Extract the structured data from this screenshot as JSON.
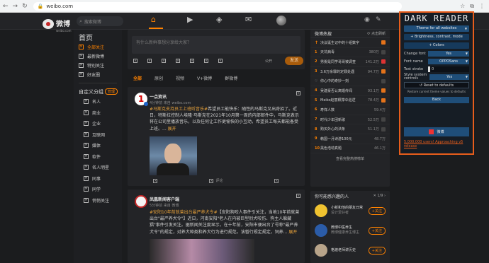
{
  "browser": {
    "url": "weibo.com"
  },
  "topbar": {
    "logo_text": "微博",
    "logo_sub": "weibo.com",
    "search_placeholder": "搜索微博"
  },
  "leftnav": {
    "title": "首页",
    "items": [
      {
        "label": "全部关注",
        "active": true
      },
      {
        "label": "最新微博"
      },
      {
        "label": "特别关注"
      },
      {
        "label": "好友圈"
      }
    ],
    "group_title": "自定义分组",
    "group_manage": "管理",
    "groups": [
      "名人",
      "商业",
      "企业",
      "互联网",
      "媒体",
      "软件",
      "名人明星",
      "同事",
      "同学",
      "悄悄关注"
    ]
  },
  "composer": {
    "placeholder": "有什么新鲜事想分享给大家？",
    "public_label": "公开",
    "send_label": "发送"
  },
  "tabs": [
    "全部",
    "原创",
    "视频",
    "V+微博",
    "群微博"
  ],
  "feed": [
    {
      "name": "一点资讯",
      "meta": "4分钟前 来自 weibo.com",
      "tag": "#马斯克支持员工上班听音乐#",
      "text": "希望员工能快乐：随性的马斯克又出奇招了。近日，特斯拉控制人埃隆·马斯克在2021年10月第一周的内部邮件中，马斯克表示将在公司里播放音乐，以及任何让工作更愉快的小互动，希望员工每天都能备受上班。...",
      "more": "展开",
      "actions": [
        "",
        "评论",
        ""
      ]
    },
    {
      "name": "凤凰新闻客户端",
      "meta": "5分钟前 来自 微博",
      "tag": "#安阳10年前就曾出台最严养犬令#",
      "text": "【安阳狗咬人事件引关注，当地10年前就曾出台\"最严养犬令\"】近日，河南安阳\"老人在内被巨型烈犬咬伤、狗主人躲藏猖\"事件引发关注。据新闻关注度显示，在十年前，安阳市便出台了号称\"最严养犬令\"的规定，对养犬种类和养犬行为进行规范。该暂行规定规定，饲养...",
      "more": "展开"
    }
  ],
  "hot": {
    "title": "微博热搜",
    "refresh": "点击刷新",
    "rows": [
      {
        "rank": "",
        "title": "决议诞生记中的十组数字",
        "num": "",
        "badge": "orange"
      },
      {
        "rank": "1",
        "title": "天坑病毒",
        "num": "380万",
        "badge": "grey"
      },
      {
        "rank": "2",
        "title": "男婴是同学哥哥被调查",
        "num": "141.2万",
        "badge": "red"
      },
      {
        "rank": "3",
        "title": "3.6万余罪的定罪处遇",
        "num": "94.7万",
        "badge": "orange"
      },
      {
        "rank": "",
        "title": "你心中的奇妙一刻",
        "num": "",
        "badge": "grey"
      },
      {
        "rank": "4",
        "title": "吴建豪否认离婚传闻",
        "num": "93.1万",
        "badge": "orange"
      },
      {
        "rank": "5",
        "title": "Meiko赵丽颖撑伞巡逻",
        "num": "78.4万",
        "badge": "orange"
      },
      {
        "rank": "6",
        "title": "寿祥人数",
        "num": "59.4万",
        "badge": "grey"
      },
      {
        "rank": "7",
        "title": "时代少年团新歌",
        "num": "52.5万",
        "badge": "grey"
      },
      {
        "rank": "8",
        "title": "购买外心的法条",
        "num": "51.1万",
        "badge": "grey"
      },
      {
        "rank": "9",
        "title": "韩国一月诗游100元",
        "num": "48.7万",
        "badge": "grey"
      },
      {
        "rank": "10",
        "title": "黑色浩劫真题",
        "num": "46.1万",
        "badge": "grey"
      }
    ],
    "footer": "查看完整热搜榜单"
  },
  "interest": {
    "title": "你可能感兴趣的人",
    "page": "1/9",
    "people": [
      {
        "name": "小新和他的朋友日常",
        "desc": "设计爱好者",
        "follow": "+关注"
      },
      {
        "name": "微博中医养生",
        "desc": "微博健康养生博主",
        "follow": "+关注"
      },
      {
        "name": "格渡老师讲历史",
        "desc": "",
        "follow": "+关注"
      }
    ]
  },
  "darkreader": {
    "title": "DARK READER",
    "theme_all": "Theme for all websites",
    "bcm": "Brightness, contrast, mode",
    "colors": "Colors",
    "change_font_label": "Change font",
    "change_font_val": "Yes",
    "font_name_label": "Font name",
    "font_name_val": "OPPOSans",
    "text_stroke_label": "Text stroke",
    "text_stroke_val": "0",
    "style_label": "Style system controls",
    "style_val": "Yes",
    "reset": "Reset to defaults",
    "reset_note": "Restore current theme values to defaults",
    "back": "Back",
    "weibo_label": "微博",
    "link": "5,000,000 users! Approaching v5 release",
    "colors_accent": "#e85d1b"
  }
}
